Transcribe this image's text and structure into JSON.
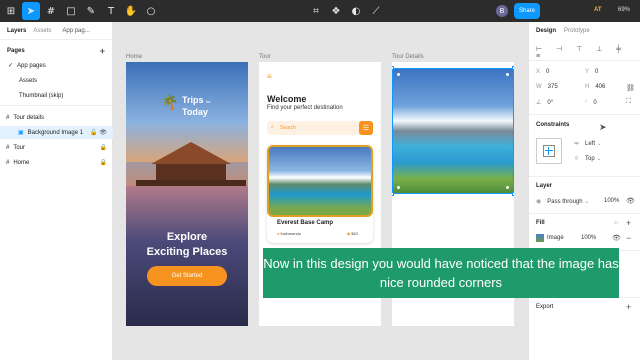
{
  "toolbar": {
    "share_label": "Share",
    "avatar_initial": "B",
    "ai_badge": "AT",
    "zoom": "69%"
  },
  "left_panel": {
    "tabs": [
      "Layers",
      "Assets"
    ],
    "page_picker": "App pag...",
    "pages_heading": "Pages",
    "pages": [
      "App pages",
      "Assets",
      "Thumbnail (skip)"
    ],
    "layers": [
      {
        "label": "Tour details"
      },
      {
        "label": "Background Image 1"
      },
      {
        "label": "Tour"
      },
      {
        "label": "Home"
      }
    ]
  },
  "canvas": {
    "frame_labels": [
      "Home",
      "Tour",
      "Tour Details"
    ],
    "home": {
      "logo_line1": "Trips",
      "logo_for": "for",
      "logo_line2": "Today",
      "headline1": "Explore",
      "headline2": "Exciting Places",
      "cta": "Get Started"
    },
    "tour": {
      "title": "Welcome",
      "subtitle": "Find your perfect destination",
      "search_placeholder": "Search",
      "card_title": "Everest Base Camp",
      "card_location": "Kathmandu",
      "card_price": "$40"
    }
  },
  "right_panel": {
    "tabs": [
      "Design",
      "Prototype"
    ],
    "x": "0",
    "y": "0",
    "w": "375",
    "h": "406",
    "rotation": "0°",
    "radius": "0",
    "constraints_heading": "Constraints",
    "constraint_h": "Left",
    "constraint_v": "Top",
    "layer_heading": "Layer",
    "blend": "Pass through",
    "opacity": "100%",
    "fill_heading": "Fill",
    "fill_type": "Image",
    "fill_opacity": "100%",
    "export_heading": "Export"
  },
  "caption": "Now in this design you would have noticed that the image has nice rounded corners",
  "colors": {
    "accent": "#0d99ff",
    "caption_bg": "#1f9b6b",
    "cta": "#f5931e"
  }
}
